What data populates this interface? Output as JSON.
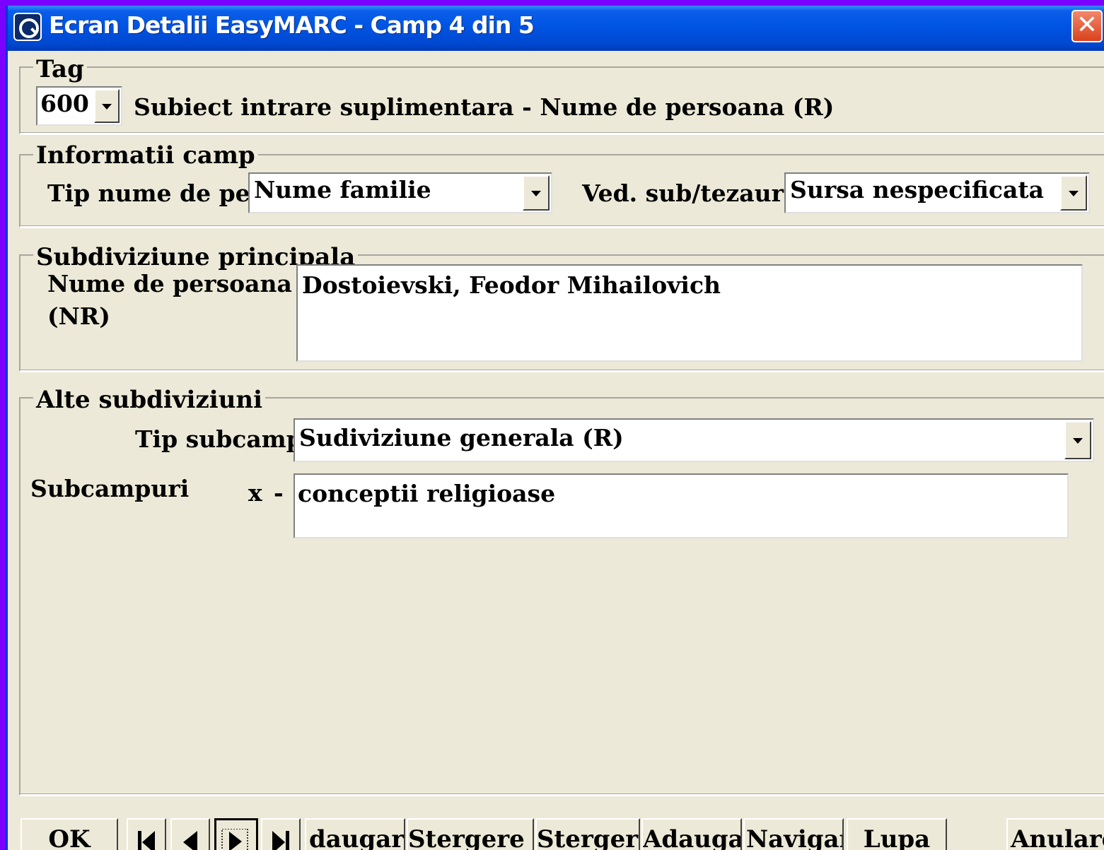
{
  "window": {
    "title": "Ecran Detalii EasyMARC - Camp 4 din 5",
    "close_glyph": "✕"
  },
  "tag": {
    "legend": "Tag",
    "value": "600",
    "description": "Subiect intrare suplimentara - Nume de persoana (R)"
  },
  "field_info": {
    "legend": "Informatii camp",
    "name_type_label": "Tip nume de per",
    "name_type_value": "Nume familie",
    "thesaurus_label": "Ved. sub/tezaur:",
    "thesaurus_value": "Sursa nespecificata"
  },
  "main_subdivision": {
    "legend": "Subdiviziune principala",
    "person_name_label_line1": "Nume de persoana",
    "person_name_label_line2": "(NR)",
    "person_name_value": "Dostoievski, Feodor Mihailovich"
  },
  "other_subdivisions": {
    "legend": "Alte subdiviziuni",
    "subfield_type_label": "Tip subcamp:",
    "subfield_type_value": "Sudiviziune generala (R)",
    "subfields_label": "Subcampuri",
    "subfield_code": "x",
    "subfield_sep": "-",
    "subfield_value": "conceptii religioase"
  },
  "buttons": {
    "ok": "OK",
    "add": "daugare",
    "delete_hash": "Stergere #",
    "delete": "Stergere",
    "add2": "Adaugare",
    "navigate": "Navigare",
    "magnifier": "Lupa",
    "cancel": "Anulare"
  },
  "icons": {
    "first": "first-record-icon",
    "prev": "previous-record-icon",
    "next": "next-record-icon",
    "last": "last-record-icon"
  }
}
